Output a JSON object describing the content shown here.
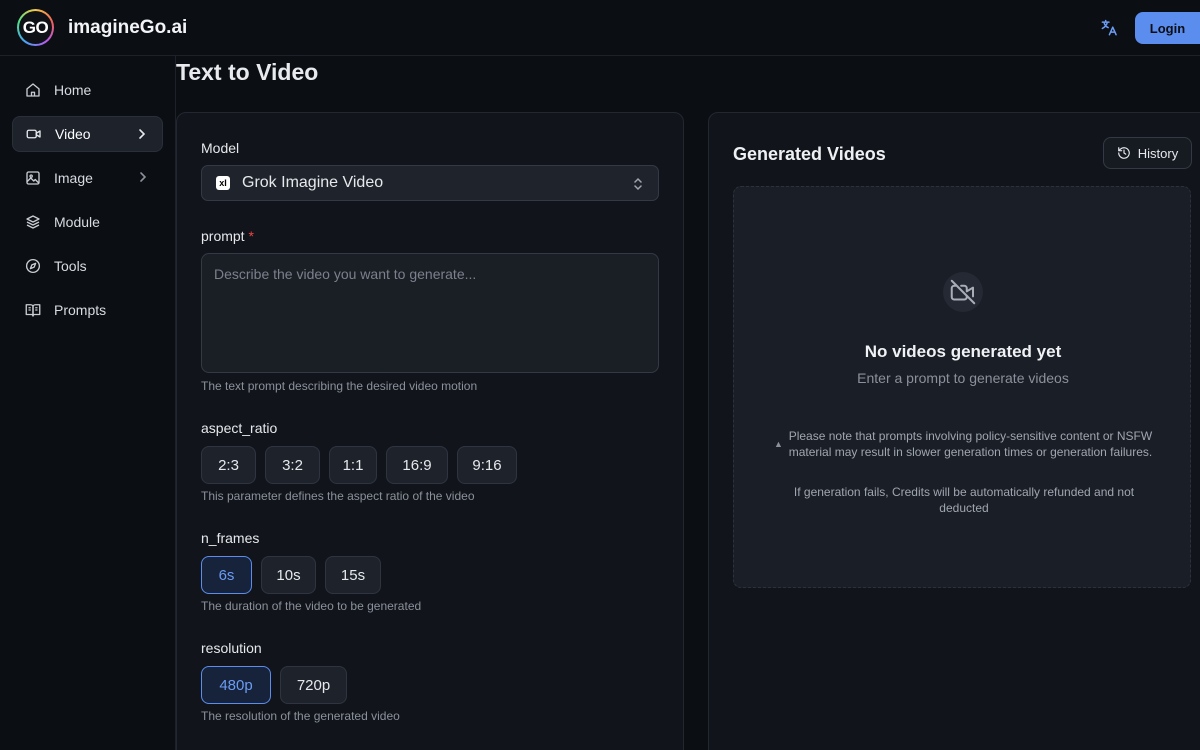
{
  "header": {
    "logo_text": "GO",
    "brand": "imagineGo.ai",
    "login_label": "Login"
  },
  "sidebar": {
    "items": [
      {
        "label": "Home",
        "icon": "home-icon"
      },
      {
        "label": "Video",
        "icon": "video-icon",
        "active": true,
        "has_submenu": true
      },
      {
        "label": "Image",
        "icon": "image-icon",
        "has_submenu": true
      },
      {
        "label": "Module",
        "icon": "layers-icon"
      },
      {
        "label": "Tools",
        "icon": "compass-icon"
      },
      {
        "label": "Prompts",
        "icon": "book-icon"
      }
    ]
  },
  "page_title": "Text to Video",
  "form": {
    "model_label": "Model",
    "model_value": "Grok Imagine Video",
    "model_icon_text": "xI",
    "prompt_label": "prompt",
    "prompt_required_mark": "*",
    "prompt_placeholder": "Describe the video you want to generate...",
    "prompt_value": "",
    "prompt_hint": "The text prompt describing the desired video motion",
    "aspect_ratio_label": "aspect_ratio",
    "aspect_ratio_options": [
      "2:3",
      "3:2",
      "1:1",
      "16:9",
      "9:16"
    ],
    "aspect_ratio_hint": "This parameter defines the aspect ratio of the video",
    "n_frames_label": "n_frames",
    "n_frames_options": [
      "6s",
      "10s",
      "15s"
    ],
    "n_frames_selected": "6s",
    "n_frames_hint": "The duration of the video to be generated",
    "resolution_label": "resolution",
    "resolution_options": [
      "480p",
      "720p"
    ],
    "resolution_selected": "480p",
    "resolution_hint": "The resolution of the generated video"
  },
  "results": {
    "title": "Generated Videos",
    "history_label": "History",
    "empty_title": "No videos generated yet",
    "empty_subtitle": "Enter a prompt to generate videos",
    "notice_icon": "▲",
    "notice_text": "Please note that prompts involving policy-sensitive content or NSFW material may result in slower generation times or generation failures.",
    "refund_text": "If generation fails, Credits will be automatically refunded and not deducted"
  },
  "colors": {
    "accent": "#5b8def",
    "background": "#0b0e13",
    "panel": "#11151b",
    "required": "#ef4444"
  }
}
